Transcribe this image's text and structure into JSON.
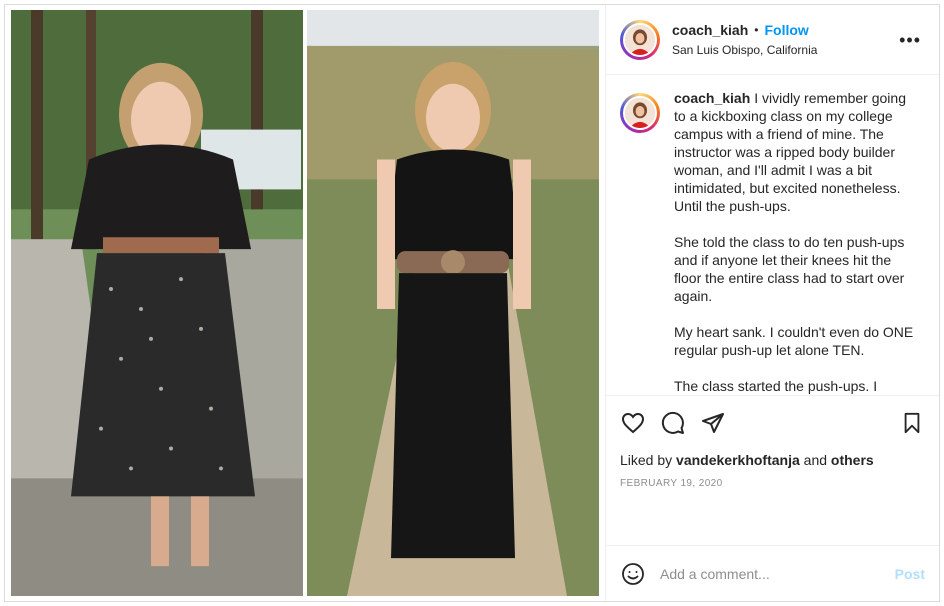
{
  "post": {
    "username": "coach_kiah",
    "follow_label": "Follow",
    "separator": "•",
    "location": "San Luis Obispo, California",
    "more_label": "•••"
  },
  "caption": {
    "username": "coach_kiah",
    "paragraphs": [
      "I vividly remember going to a kickboxing class on my college campus with a friend of mine. The instructor was a ripped body builder woman, and I'll admit I was a bit intimidated, but excited nonetheless. Until the push-ups.",
      "She told the class to do ten push-ups and if anyone let their knees hit the floor the entire class had to start over again.",
      "My heart sank. I couldn't even do ONE regular push-up let alone TEN.",
      "The class started the push-ups. I shakily did one, two, maybe three, but I just couldn't hold myself up any"
    ]
  },
  "engagement": {
    "liked_by_prefix": "Liked by",
    "liked_by_user": "vandekerkhoftanja",
    "liked_by_and": "and",
    "liked_by_others": "others",
    "date": "FEBRUARY 19, 2020"
  },
  "comment": {
    "placeholder": "Add a comment...",
    "post_label": "Post"
  },
  "icons": {
    "like": "heart-icon",
    "comment": "comment-icon",
    "share": "share-icon",
    "save": "bookmark-icon",
    "emoji": "emoji-icon",
    "more": "more-options-icon"
  },
  "colors": {
    "accent": "#0095f6",
    "post_disabled": "#b2dffc",
    "muted": "#8e8e8e",
    "border": "#dbdbdb"
  }
}
